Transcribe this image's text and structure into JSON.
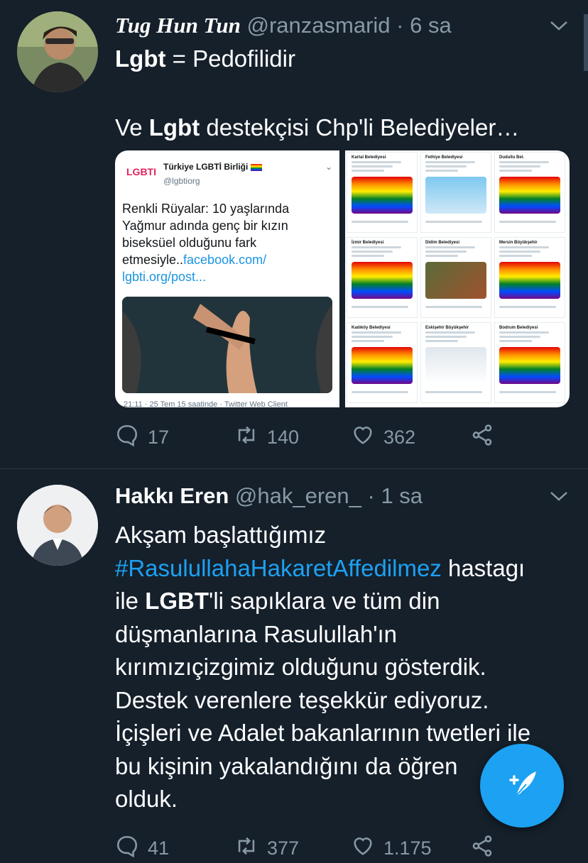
{
  "tweets": [
    {
      "name": "Tug Hun Tun",
      "handle": "@ranzasmarid",
      "dot": "·",
      "time": "6 sa",
      "line1_bold": "Lgbt",
      "line1_rest": " = Pedofilidir",
      "line2_pre": "Ve ",
      "line2_bold": "Lgbt",
      "line2_rest": " destekçisi Chp'li Belediyeler…",
      "media": {
        "left": {
          "logo": "LGBTI",
          "account_name": "Türkiye LGBTİ Birliği",
          "account_handle": "@lgbtiorg",
          "text": "Renkli Rüyalar: 10 yaşlarında Yağmur adında genç bir kızın biseksüel olduğunu fark etmesiyle..",
          "link1": "facebook.com/",
          "link2": "lgbti.org/post...",
          "footer": "21:11 · 25 Tem 15 saatinde · Twitter Web Client"
        },
        "right_cells": [
          {
            "name": "Kartal Belediyesi"
          },
          {
            "name": "Fethiye Belediyesi"
          },
          {
            "name": "Dudullu Bel."
          },
          {
            "name": "İzmir Belediyesi"
          },
          {
            "name": "Didim Belediyesi"
          },
          {
            "name": "Mersin Büyükşehir"
          },
          {
            "name": "Kadıköy Belediyesi"
          },
          {
            "name": "Eskişehir Büyükşehir"
          },
          {
            "name": "Bodrum Belediyesi"
          }
        ]
      },
      "replies": "17",
      "retweets": "140",
      "likes": "362"
    },
    {
      "name": "Hakkı Eren",
      "handle": "@hak_eren_",
      "dot": "·",
      "time": "1 sa",
      "l1": "Akşam başlattığımız",
      "hashtag": "#RasulullahaHakaretAffedilmez",
      "l2_rest": " hastagı",
      "l3_pre": "ile ",
      "l3_bold": "LGBT",
      "l3_rest": "'li sapıklara ve tüm din",
      "l4": "düşmanlarına Rasulullah'ın",
      "l5": "kırımızıçizgimiz olduğunu gösterdik.",
      "l6": "Destek verenlere teşekkür ediyoruz.",
      "l7": "İçişleri ve Adalet bakanlarının twetleri ile",
      "l8": "bu kişinin yakalandığını da öğren",
      "l9": "olduk.",
      "replies": "41",
      "retweets": "377",
      "likes": "1.175"
    }
  ],
  "colors": {
    "background": "#15202b",
    "accent": "#1da1f2",
    "muted": "#8899a6"
  },
  "icons": [
    "reply-icon",
    "retweet-icon",
    "like-icon",
    "share-icon",
    "caret-down-icon",
    "compose-tweet-icon"
  ]
}
